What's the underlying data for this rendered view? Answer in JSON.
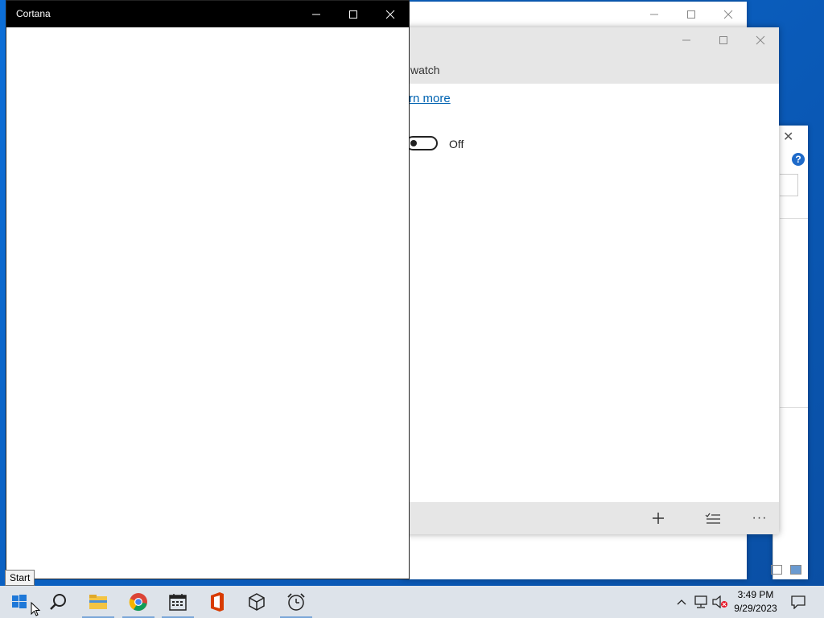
{
  "cortana": {
    "title": "Cortana",
    "minimize_label": "—",
    "maximize_label": "☐",
    "close_label": "✕"
  },
  "middle_window": {
    "heading_fragment": "watch",
    "link_fragment": "rn more",
    "toggle_state": "Off",
    "bottom_add": "+",
    "bottom_more": "···"
  },
  "back_window": {
    "help": "?"
  },
  "tooltip": {
    "text": "Start"
  },
  "taskbar": {
    "clock_time": "3:49 PM",
    "clock_date": "9/29/2023",
    "icons": [
      "windows-start-icon",
      "search-icon",
      "file-explorer-icon",
      "chrome-icon",
      "calendar-icon",
      "office-icon",
      "3d-box-icon",
      "alarm-clock-icon"
    ]
  },
  "colors": {
    "desktop": "#0a63c9",
    "taskbar": "#dde3ea",
    "link": "#0063b1",
    "titlebar_dark": "#000000"
  }
}
